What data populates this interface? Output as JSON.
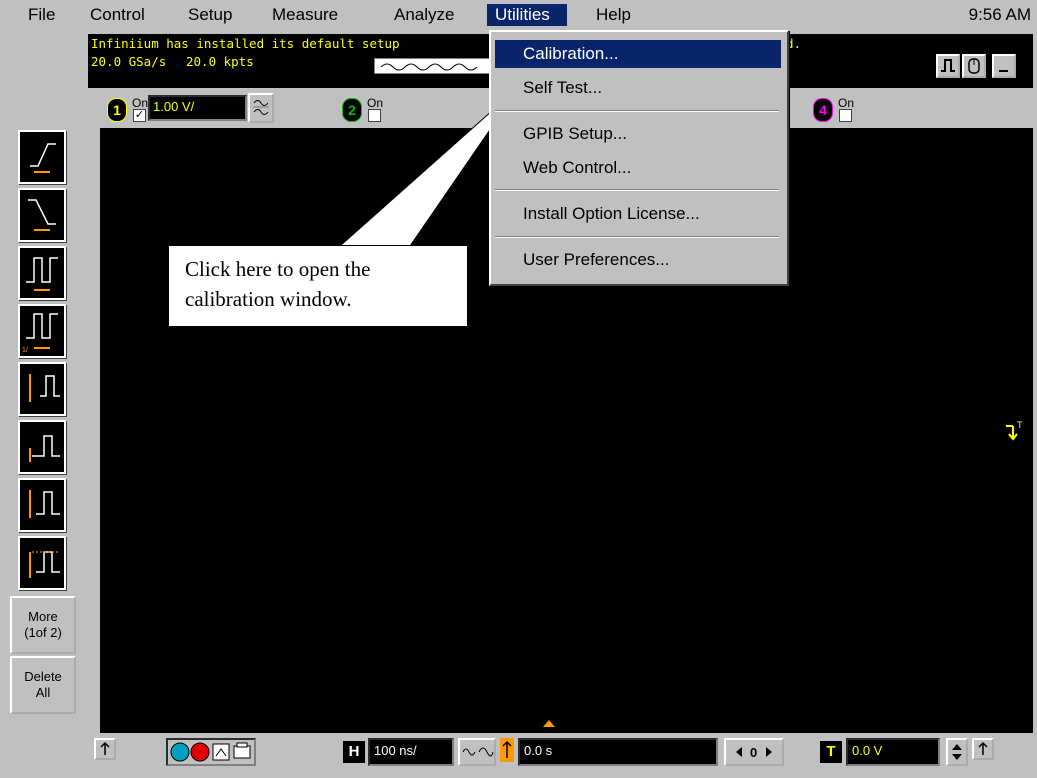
{
  "menubar": {
    "items": [
      "File",
      "Control",
      "Setup",
      "Measure",
      "Analyze",
      "Utilities",
      "Help"
    ],
    "active": "Utilities",
    "clock": "9:56 AM"
  },
  "infobar": {
    "message_left": "Infiniium has installed its default setup",
    "message_right": "d.",
    "sample_rate": "20.0 GSa/s",
    "memory_depth": "20.0 kpts"
  },
  "channels": {
    "on_label": "On",
    "ch1": {
      "number": "1",
      "scale": "1.00 V/",
      "checked": true,
      "color": "#ffff00"
    },
    "ch2": {
      "number": "2",
      "checked": false,
      "color": "#00c000"
    },
    "ch4": {
      "number": "4",
      "checked": false,
      "color": "#ff00ff"
    }
  },
  "utilities_menu": {
    "items": [
      "Calibration...",
      "Self Test...",
      "GPIB Setup...",
      "Web Control...",
      "Install Option License...",
      "User Preferences..."
    ],
    "highlighted": "Calibration..."
  },
  "callout": {
    "text": "Click here to open the calibration window."
  },
  "side_panel": {
    "more_label": "More\n(1of 2)",
    "delete_label": "Delete\nAll"
  },
  "bottombar": {
    "horizontal_label": "H",
    "horizontal_scale": "100 ns/",
    "delay": "0.0 s",
    "trigger_label": "T",
    "trigger_level": "0.0 V"
  },
  "colors": {
    "screen": "#000000",
    "trace_yellow": "#ffff00",
    "menu_highlight": "#0a246a",
    "orange": "#ff9900"
  }
}
